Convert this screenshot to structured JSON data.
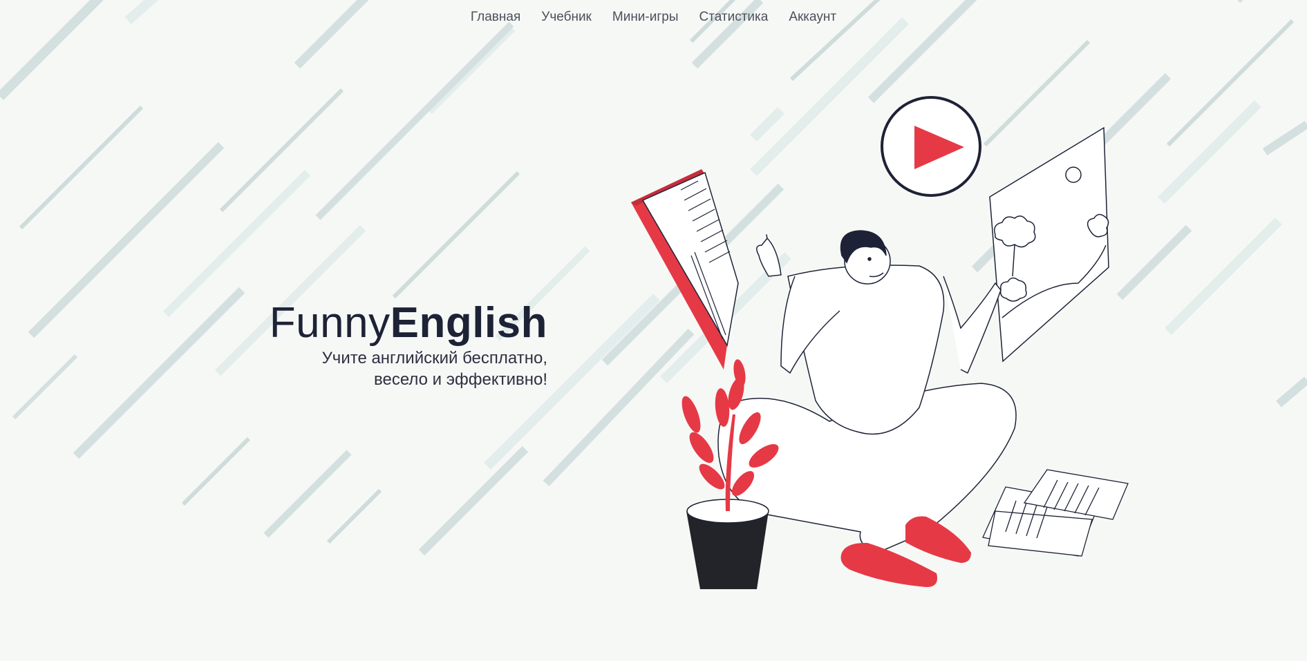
{
  "nav": {
    "items": [
      {
        "label": "Главная"
      },
      {
        "label": "Учебник"
      },
      {
        "label": "Мини-игры"
      },
      {
        "label": "Статистика"
      },
      {
        "label": "Аккаунт"
      }
    ]
  },
  "hero": {
    "brand_light": "Funny",
    "brand_bold": "English",
    "tagline_line1": "Учите английский бесплатно,",
    "tagline_line2": "весело и эффективно!"
  },
  "colors": {
    "accent": "#e63946",
    "dark": "#1e2236",
    "background": "#f6f8f6",
    "stripe": "#cfdcdb"
  },
  "icons": {
    "play": "play-icon"
  }
}
